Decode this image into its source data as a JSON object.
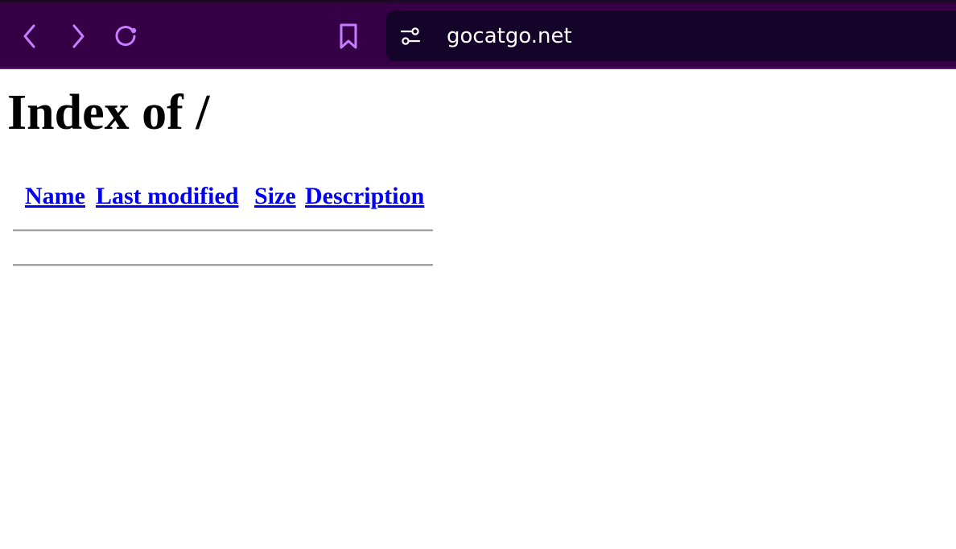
{
  "browser": {
    "url": "gocatgo.net",
    "icons": {
      "back": "chevron-left-icon",
      "forward": "chevron-right-icon",
      "reload": "reload-icon",
      "bookmark": "bookmark-icon",
      "site_settings": "sliders-icon"
    },
    "colors": {
      "toolbar": "#360046",
      "address_bar": "#14042a",
      "icon_accent": "#c77dff"
    }
  },
  "page": {
    "heading": "Index of /",
    "columns": {
      "name": "Name",
      "last_modified": "Last modified",
      "size": "Size",
      "description": "Description"
    },
    "entries": [],
    "colors": {
      "link": "#0000ee",
      "text": "#000000"
    }
  }
}
